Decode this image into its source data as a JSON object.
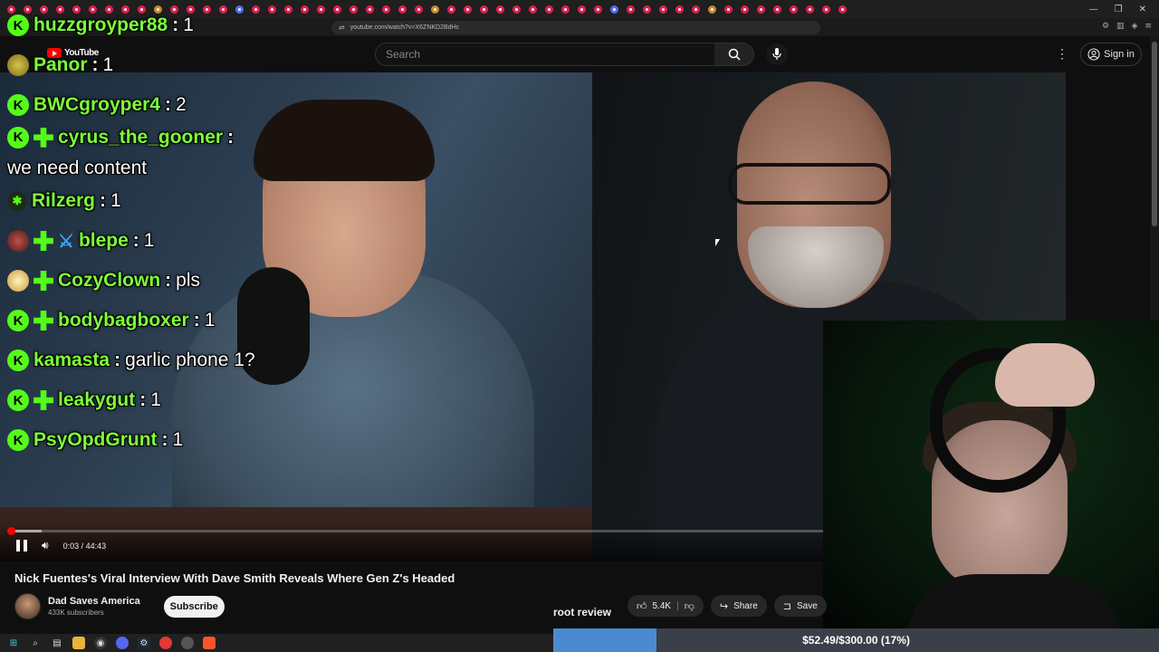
{
  "browser": {
    "url": "youtube.com/watch?v=X6ZNKD2BdHc",
    "window_controls": [
      "—",
      "❐",
      "✕"
    ]
  },
  "youtube": {
    "logo_text": "YouTube",
    "search_placeholder": "Search",
    "sign_in": "Sign in"
  },
  "chat": [
    {
      "user": "huzzgroyper88",
      "text": "1",
      "badges": [
        "k"
      ]
    },
    {
      "user": "Panor",
      "text": "1",
      "badges": [
        "avatar-yellow"
      ]
    },
    {
      "user": "BWCgroyper4",
      "text": "2",
      "badges": [
        "k"
      ]
    },
    {
      "user": "cyrus_the_gooner",
      "text": "we need content",
      "badges": [
        "k",
        "gem"
      ]
    },
    {
      "user": "Rilzerg",
      "text": "1",
      "badges": [
        "star"
      ]
    },
    {
      "user": "blepe",
      "text": "1",
      "badges": [
        "avatar-red",
        "gem",
        "sword"
      ]
    },
    {
      "user": "CozyClown",
      "text": "pls",
      "badges": [
        "avatar-clown",
        "gem"
      ]
    },
    {
      "user": "bodybagboxer",
      "text": "1",
      "badges": [
        "k",
        "gem"
      ]
    },
    {
      "user": "kamasta",
      "text": "garlic phone 1?",
      "badges": [
        "k"
      ]
    },
    {
      "user": "leakygut",
      "text": "1",
      "badges": [
        "k",
        "gem"
      ]
    },
    {
      "user": "PsyOpdGrunt",
      "text": "1",
      "badges": [
        "k"
      ]
    }
  ],
  "player": {
    "current_time": "0:03",
    "duration": "44:43",
    "time_display": "0:03 / 44:43",
    "played_fraction": 0.0012,
    "buffered_fraction": 0.04
  },
  "video": {
    "title": "Nick Fuentes's Viral Interview With Dave Smith Reveals Where Gen Z's Headed",
    "channel": "Dad Saves America",
    "subscribers": "433K subscribers",
    "subscribe_label": "Subscribe",
    "likes": "5.4K",
    "share_label": "Share",
    "save_label": "Save"
  },
  "stream_overlay": {
    "label": "root review",
    "goal_text": "$52.49/$300.00 (17%)",
    "goal_fraction": 0.17
  },
  "colors": {
    "kick_green": "#53fc18",
    "username_green": "#7cff3a",
    "yt_red": "#ff0000",
    "goal_blue": "#4a8bd0"
  }
}
